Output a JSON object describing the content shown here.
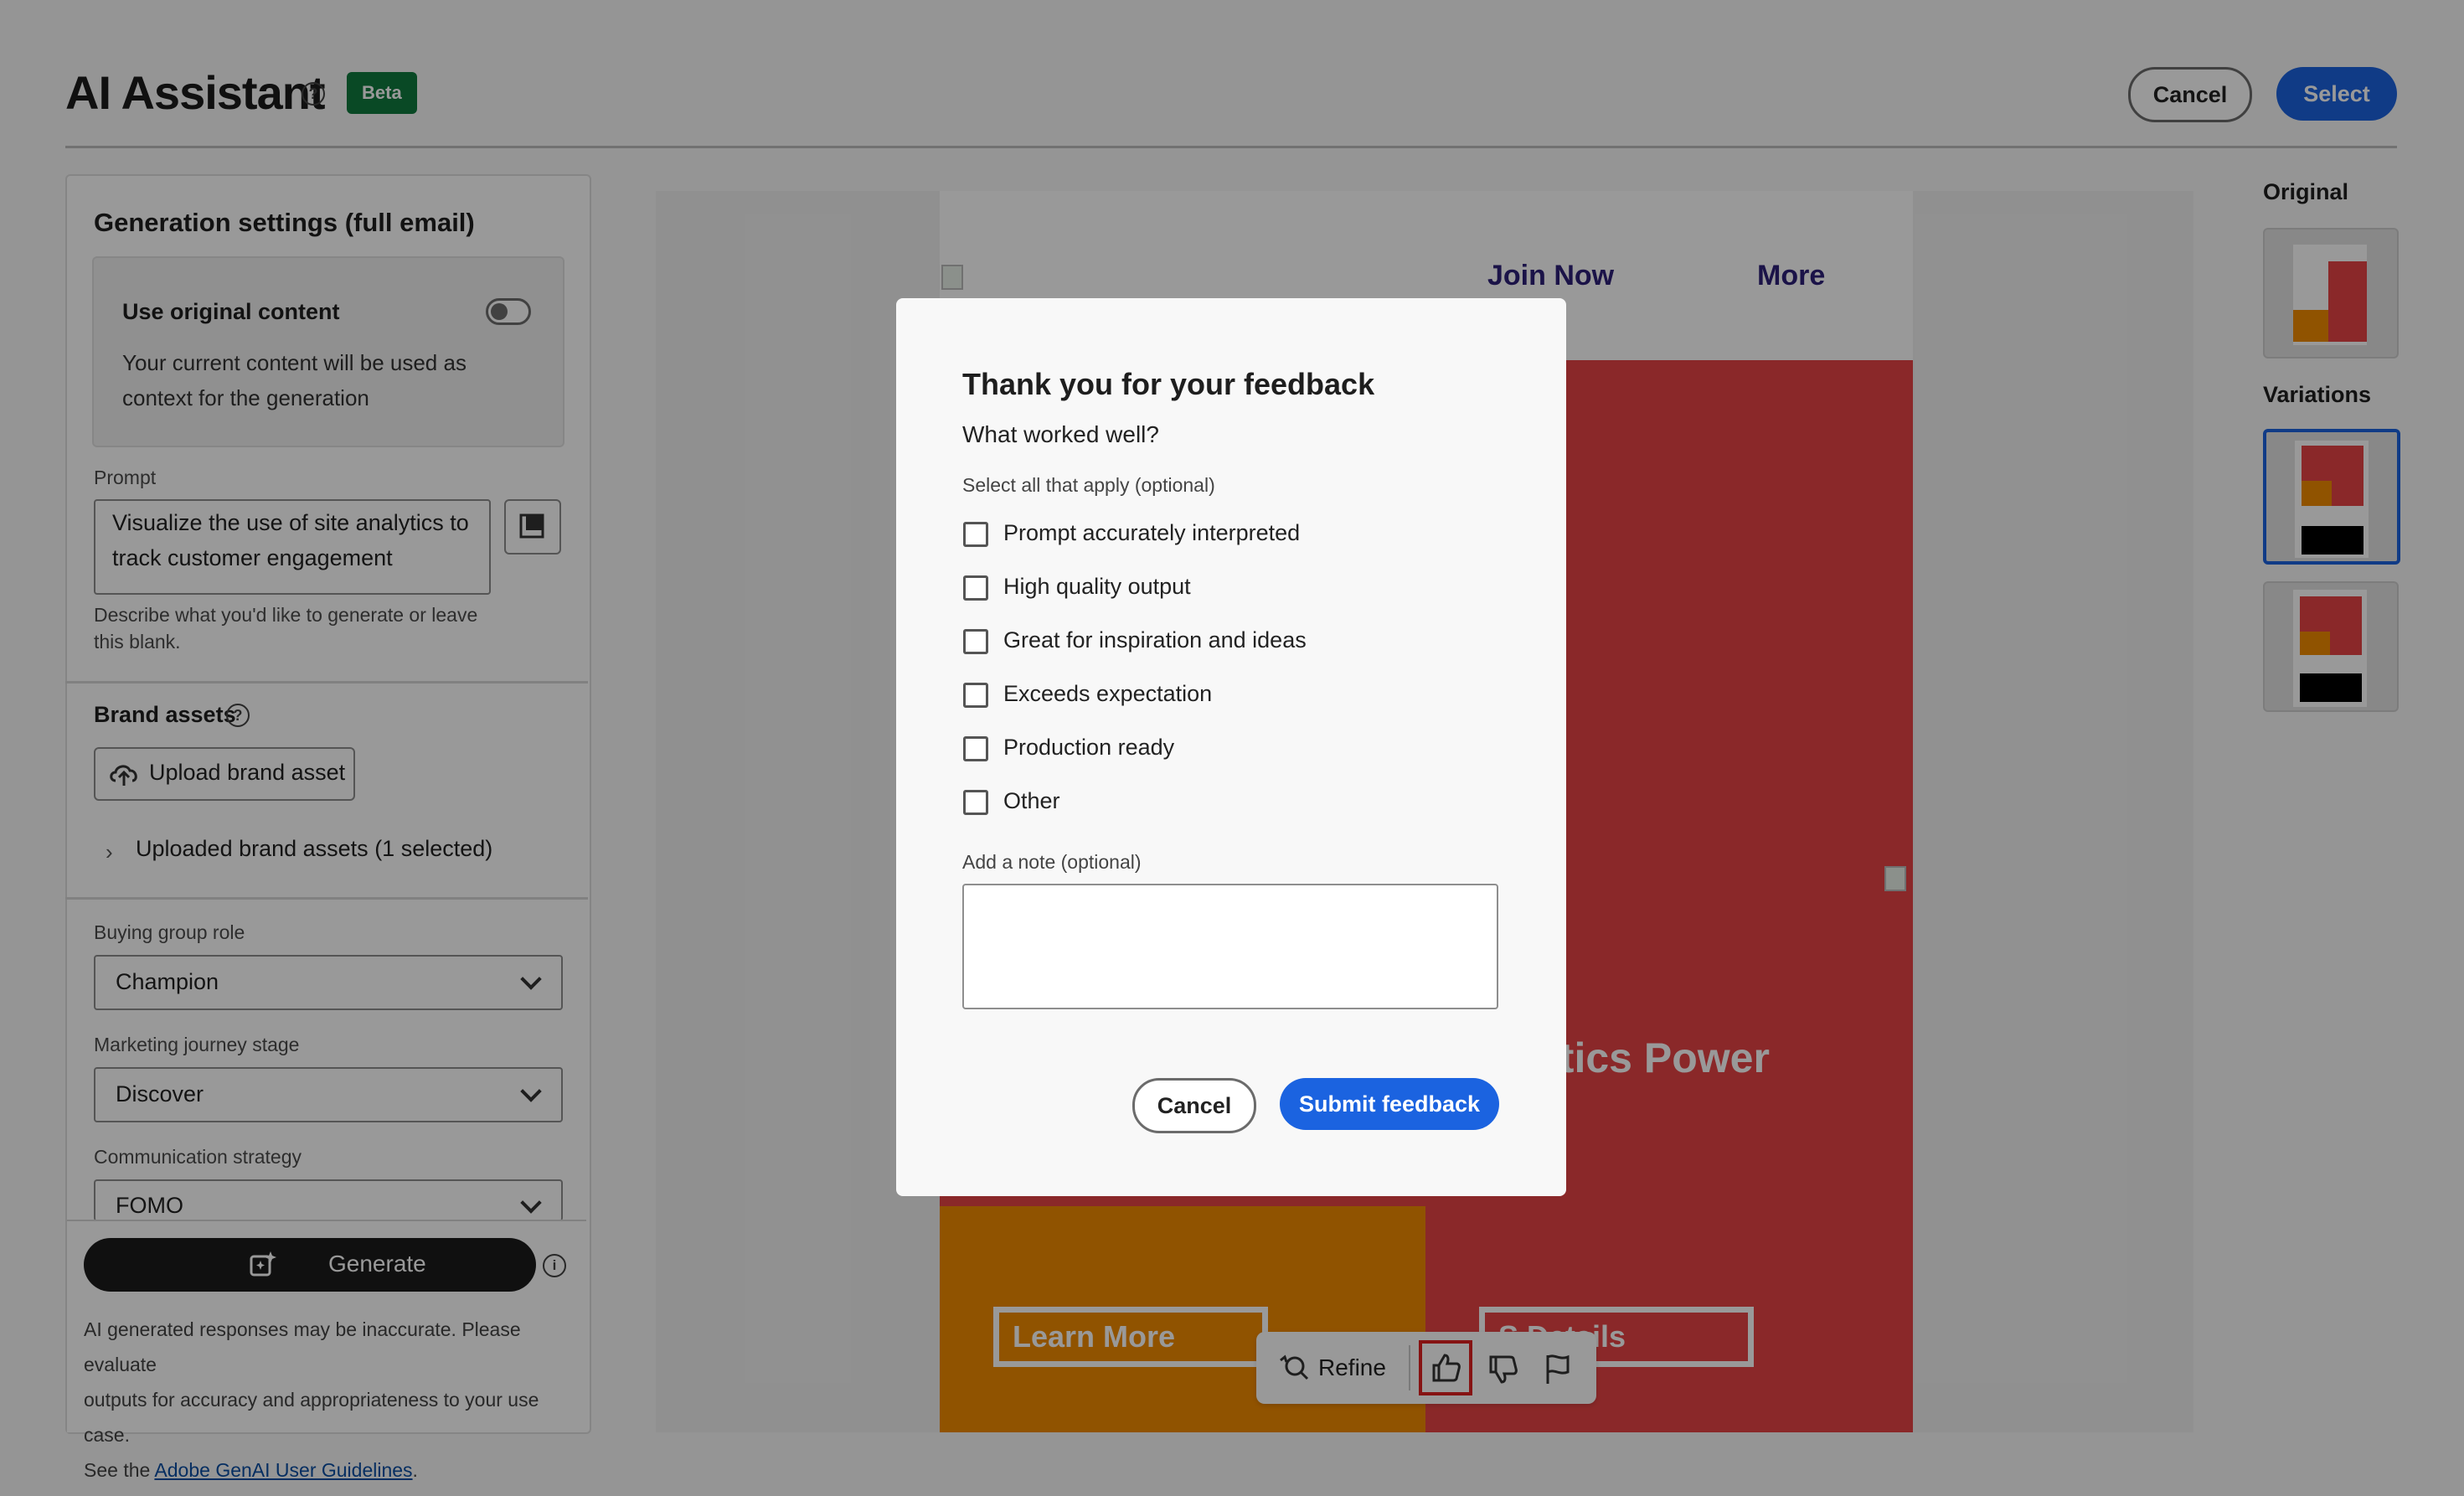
{
  "header": {
    "title": "AI Assistant",
    "beta": "Beta",
    "cancel": "Cancel",
    "select": "Select"
  },
  "settings": {
    "title": "Generation settings (full email)",
    "use_original_label": "Use original content",
    "use_original_on": false,
    "use_original_desc_1": "Your current content will be used as",
    "use_original_desc_2": "context for the generation",
    "prompt_label": "Prompt",
    "prompt_value_1": "Visualize the use of site analytics to",
    "prompt_value_2": "track customer engagement",
    "prompt_help_1": "Describe what you'd like to generate or leave",
    "prompt_help_2": "this blank.",
    "brand_title": "Brand assets",
    "upload_label": "Upload brand asset",
    "uploaded_label": "Uploaded brand assets (1 selected)",
    "buying_role_label": "Buying group role",
    "buying_role_value": "Champion",
    "journey_label": "Marketing journey stage",
    "journey_value": "Discover",
    "strategy_label": "Communication strategy",
    "strategy_value": "FOMO",
    "generate_label": "Generate",
    "disclaimer_1": "AI generated responses may be inaccurate. Please evaluate",
    "disclaimer_2": "outputs for accuracy and appropriateness to your use case.",
    "disclaimer_3": "See the ",
    "disclaimer_link": "Adobe GenAI User Guidelines",
    "disclaimer_end": "."
  },
  "preview": {
    "nav_join": "Join Now",
    "nav_more": "More",
    "hero_partial": "ytics Power",
    "cta_learn": "Learn More",
    "cta_details_partial": "S   Details",
    "colors": {
      "red": "#e64445",
      "orange": "#f18a00"
    }
  },
  "rail": {
    "original": "Original",
    "variations": "Variations"
  },
  "toolbar": {
    "refine": "Refine"
  },
  "modal": {
    "title": "Thank you for your feedback",
    "subtitle": "What worked well?",
    "hint": "Select all that apply (optional)",
    "options": [
      "Prompt accurately interpreted",
      "High quality output",
      "Great for inspiration and ideas",
      "Exceeds expectation",
      "Production ready",
      "Other"
    ],
    "note_label": "Add a note (optional)",
    "cancel": "Cancel",
    "submit": "Submit feedback"
  }
}
